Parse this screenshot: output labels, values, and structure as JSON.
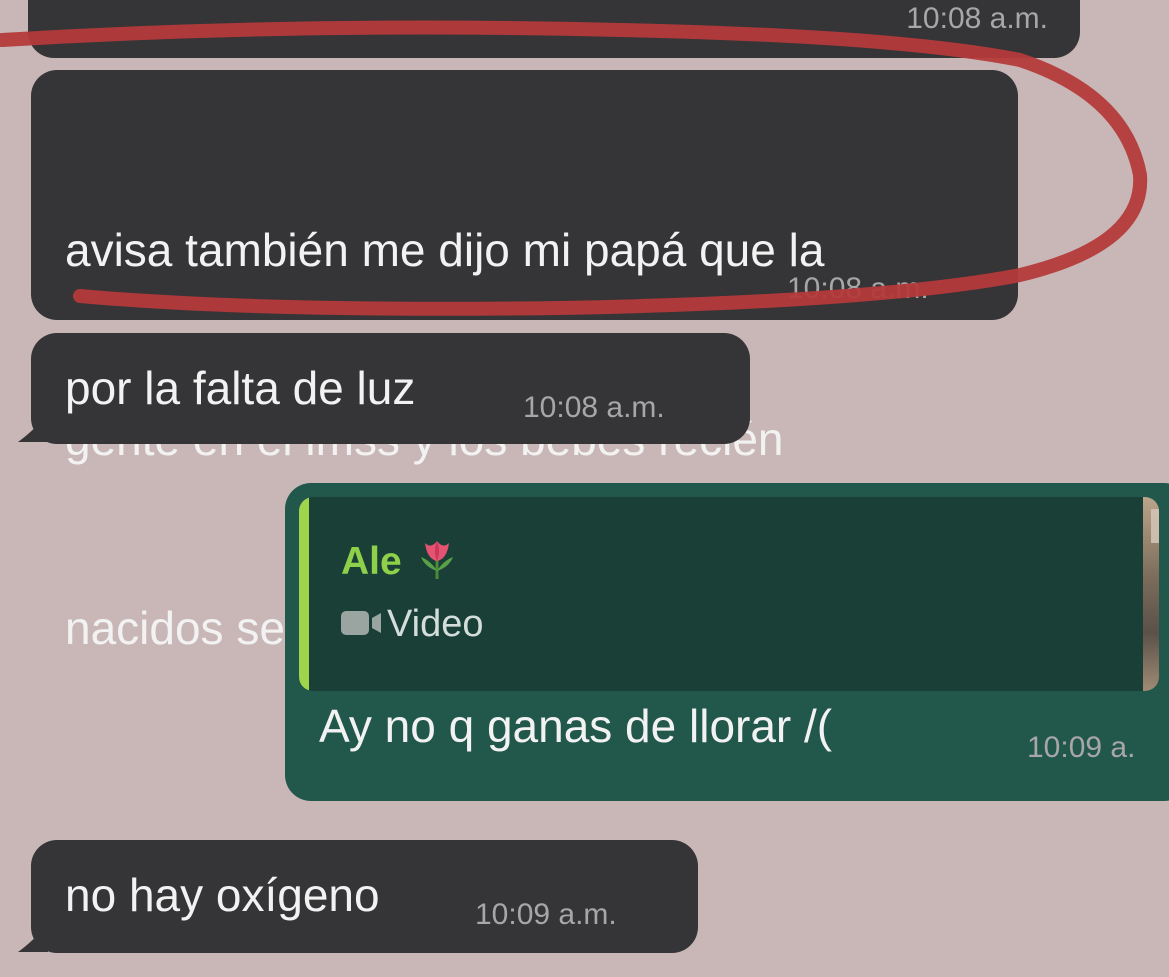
{
  "messages": [
    {
      "time": "10:08 a.m."
    },
    {
      "lines": [
        "avisa también me dijo mi papá que la",
        "gente en el imss y los bebés recién",
        "nacidos se están muriendo"
      ],
      "time": "10:08 a.m."
    },
    {
      "text": "por la falta de luz",
      "time": "10:08 a.m."
    },
    {
      "quote_author": "Ale",
      "quote_author_emoji": "🌷",
      "quote_type": "Video",
      "text": "Ay no q ganas de llorar /(",
      "time": "10:09 a."
    },
    {
      "text": "no hay oxígeno",
      "time": "10:09 a.m."
    }
  ],
  "colors": {
    "background": "#c9b7b7",
    "incoming_bubble": "#353437",
    "outgoing_bubble": "#22574b",
    "quote_bar": "#9ed54c",
    "annotation_stroke": "#b43a3a"
  },
  "icons": {
    "tulip": "tulip-icon",
    "video": "video-icon",
    "reply_bar": "reply-bar"
  }
}
